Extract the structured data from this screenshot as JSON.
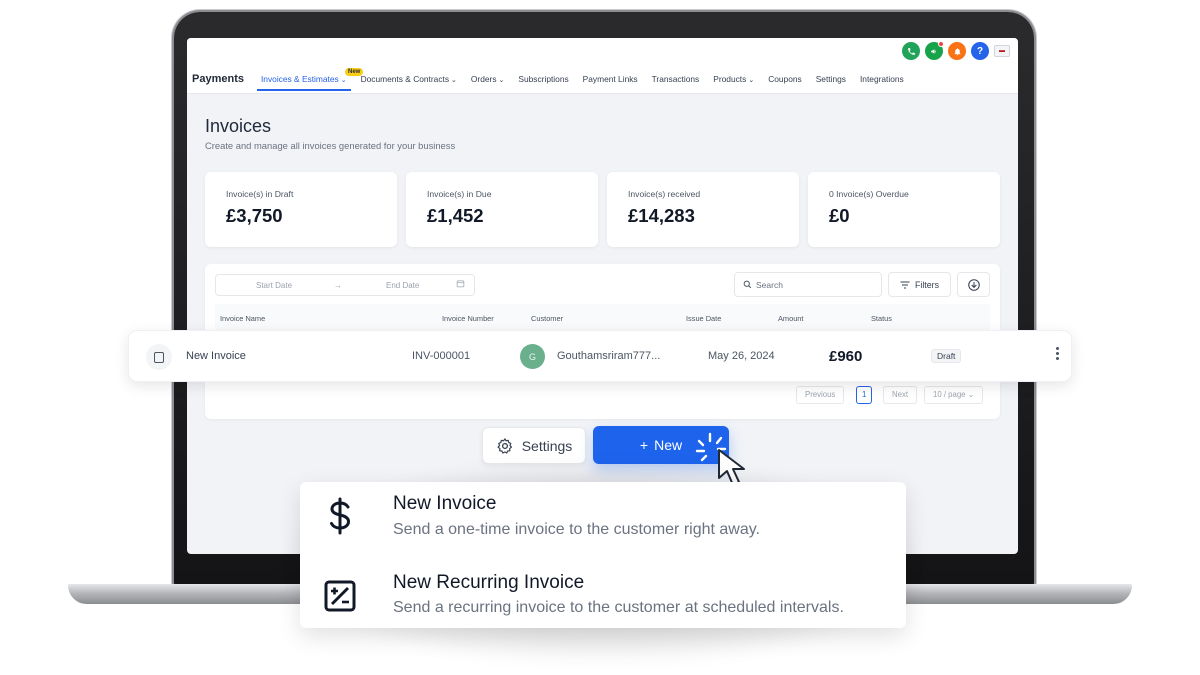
{
  "topbar": {
    "brand": "Payments",
    "nav": [
      {
        "label": "Invoices & Estimates",
        "badge": "New",
        "has_chevron": true,
        "active": true
      },
      {
        "label": "Documents & Contracts",
        "has_chevron": true
      },
      {
        "label": "Orders",
        "has_chevron": true
      },
      {
        "label": "Subscriptions"
      },
      {
        "label": "Payment Links"
      },
      {
        "label": "Transactions"
      },
      {
        "label": "Products",
        "has_chevron": true
      },
      {
        "label": "Coupons"
      },
      {
        "label": "Settings"
      },
      {
        "label": "Integrations"
      }
    ],
    "icons": [
      "phone-icon",
      "megaphone-icon",
      "bell-icon",
      "help-icon",
      "language-flag-icon"
    ],
    "help_glyph": "?"
  },
  "page": {
    "title": "Invoices",
    "subtitle": "Create and manage all invoices generated for your business"
  },
  "stats": [
    {
      "label": "Invoice(s) in Draft",
      "value": "£3,750"
    },
    {
      "label": "Invoice(s) in Due",
      "value": "£1,452"
    },
    {
      "label": "Invoice(s) received",
      "value": "£14,283"
    },
    {
      "label": "0 Invoice(s) Overdue",
      "value": "£0"
    }
  ],
  "filters": {
    "start_date_placeholder": "Start Date",
    "end_date_placeholder": "End Date",
    "search_placeholder": "Search",
    "filters_label": "Filters"
  },
  "table": {
    "columns": [
      "Invoice Name",
      "Invoice Number",
      "Customer",
      "Issue Date",
      "Amount",
      "Status"
    ],
    "row": {
      "name": "New Invoice",
      "number": "INV-000001",
      "avatar_initial": "G",
      "customer": "Gouthamsriram777...",
      "issue_date": "May 26, 2024",
      "amount": "£960",
      "status": "Draft"
    }
  },
  "pagination": {
    "previous": "Previous",
    "current_page": "1",
    "next": "Next",
    "per_page": "10 / page"
  },
  "actions": {
    "settings_label": "Settings",
    "new_label": "New",
    "new_plus": "+"
  },
  "menu": {
    "items": [
      {
        "title": "New Invoice",
        "description": "Send a one-time invoice to the customer right away.",
        "icon": "dollar-icon"
      },
      {
        "title": "New Recurring Invoice",
        "description": "Send a recurring invoice to the customer at scheduled intervals.",
        "icon": "percent-box-icon"
      }
    ]
  },
  "colors": {
    "accent": "#1d63ec",
    "draft_badge_bg": "#f3f4f6",
    "avatar_bg": "#6ab08d"
  }
}
